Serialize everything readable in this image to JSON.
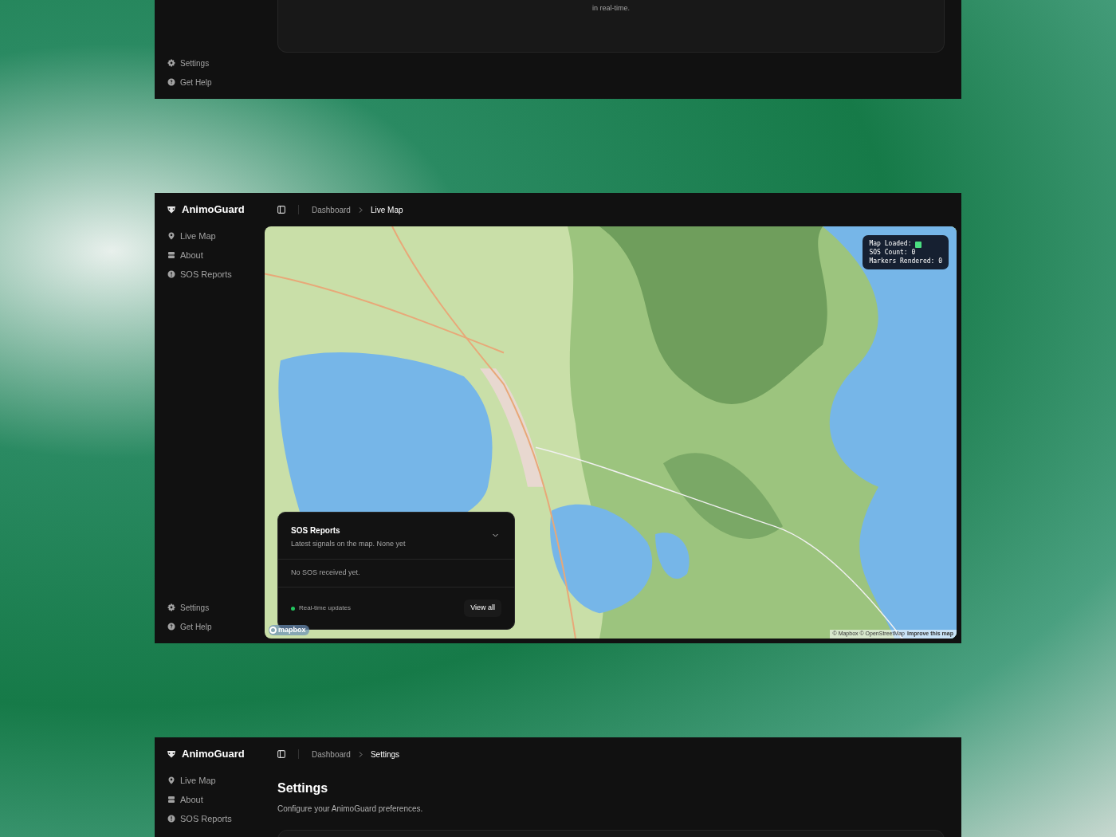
{
  "top_panel": {
    "card_text": "in real-time.",
    "footer_nav": [
      {
        "label": "Settings",
        "kind": "gear"
      },
      {
        "label": "Get Help",
        "kind": "help"
      }
    ]
  },
  "map_panel": {
    "brand": "AnimoGuard",
    "nav": [
      {
        "label": "Live Map",
        "kind": "pin"
      },
      {
        "label": "About",
        "kind": "stack"
      },
      {
        "label": "SOS Reports",
        "kind": "alert"
      }
    ],
    "footer_nav": [
      {
        "label": "Settings",
        "kind": "gear"
      },
      {
        "label": "Get Help",
        "kind": "help"
      }
    ],
    "breadcrumb": [
      "Dashboard",
      "Live Map"
    ],
    "debug": {
      "loaded_label": "Map Loaded:",
      "map_loaded": true,
      "lines": [
        "SOS Count: 0",
        "Markers Rendered: 0"
      ]
    },
    "sos_panel": {
      "title": "SOS Reports",
      "subtitle": "Latest signals on the map. None yet",
      "empty_text": "No SOS received yet.",
      "status": "Real-time updates",
      "live": true,
      "button": "View all"
    },
    "attribution": {
      "logo": "mapbox",
      "credits": "© Mapbox © OpenStreetMap",
      "link": "Improve this map"
    }
  },
  "settings_panel": {
    "brand": "AnimoGuard",
    "nav": [
      {
        "label": "Live Map",
        "kind": "pin"
      },
      {
        "label": "About",
        "kind": "stack"
      },
      {
        "label": "SOS Reports",
        "kind": "alert"
      }
    ],
    "breadcrumb": [
      "Dashboard",
      "Settings"
    ],
    "heading": "Settings",
    "subtitle": "Configure your AnimoGuard preferences."
  }
}
